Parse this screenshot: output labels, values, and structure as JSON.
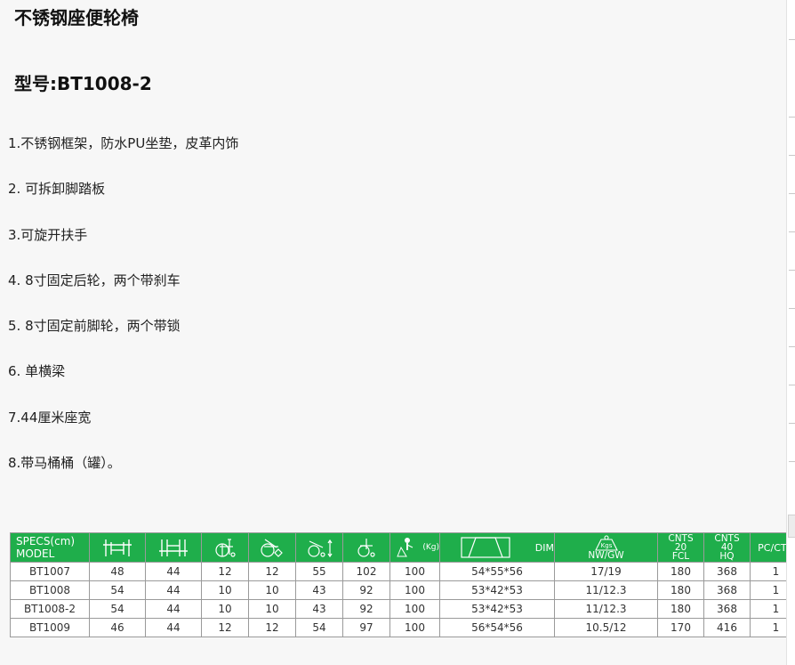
{
  "product": {
    "title": "不锈钢座便轮椅",
    "model_line": "型号:BT1008-2"
  },
  "features": [
    "1.不锈钢框架，防水PU坐垫，皮革内饰",
    "2. 可拆卸脚踏板",
    "3.可旋开扶手",
    "4. 8寸固定后轮，两个带刹车",
    "5. 8寸固定前脚轮，两个带锁",
    "6. 单横梁",
    "7.44厘米座宽",
    "8.带马桶桶（罐）。"
  ],
  "spec_table": {
    "header": {
      "specs_label": "SPECS(cm)",
      "model_label": "MODEL",
      "weight_unit": "(Kg)",
      "dim_label": "DIM",
      "kgs_label": "Kgs",
      "nwgw_label": "NW/GW",
      "cnts20": [
        "CNTS",
        "20",
        "FCL"
      ],
      "cnts40": [
        "CNTS",
        "40",
        "HQ"
      ],
      "pcctn_label": "PC/CTN"
    },
    "icons": [
      "overall-width-icon",
      "seat-width-icon",
      "rear-wheel-icon",
      "front-wheel-icon",
      "seat-height-icon",
      "overall-height-icon",
      "max-weight-icon",
      "carton-dimension-icon",
      "net-gross-weight-icon"
    ],
    "rows": [
      [
        "BT1007",
        "48",
        "44",
        "12",
        "12",
        "55",
        "102",
        "100",
        "54*55*56",
        "17/19",
        "180",
        "368",
        "1"
      ],
      [
        "BT1008",
        "54",
        "44",
        "10",
        "10",
        "43",
        "92",
        "100",
        "53*42*53",
        "11/12.3",
        "180",
        "368",
        "1"
      ],
      [
        "BT1008-2",
        "54",
        "44",
        "10",
        "10",
        "43",
        "92",
        "100",
        "53*42*53",
        "11/12.3",
        "180",
        "368",
        "1"
      ],
      [
        "BT1009",
        "46",
        "44",
        "12",
        "12",
        "54",
        "97",
        "100",
        "56*54*56",
        "10.5/12",
        "170",
        "416",
        "1"
      ]
    ],
    "colors": {
      "header_bg": "#1fae4b",
      "header_text": "#ffffff",
      "border": "#9a9a9a"
    }
  }
}
